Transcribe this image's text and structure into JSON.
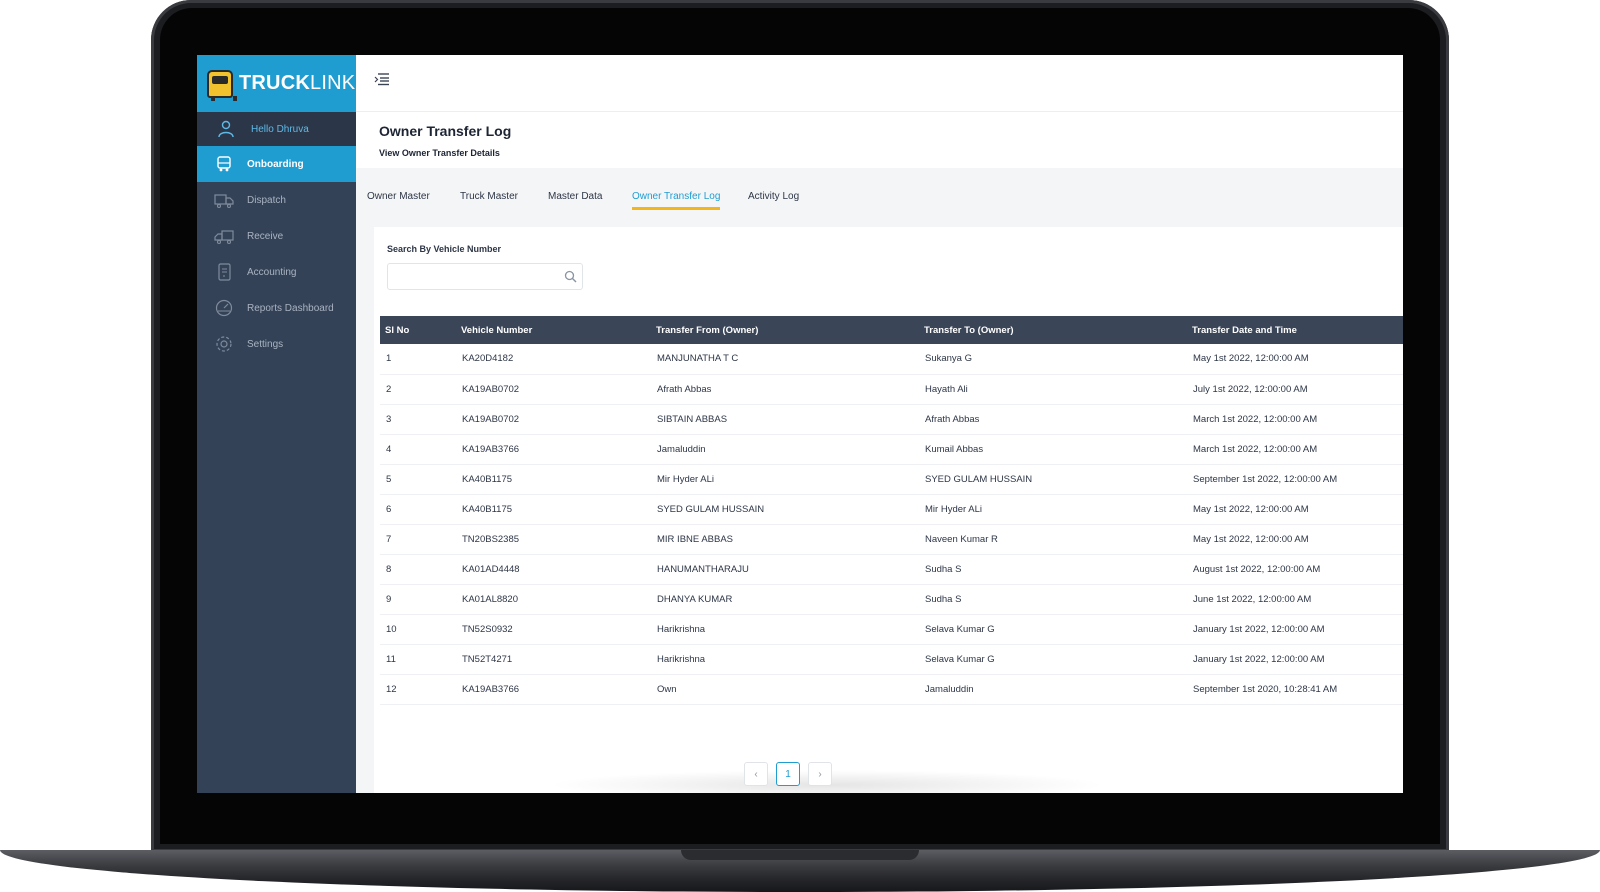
{
  "app": {
    "logo_bold": "TRUCK",
    "logo_light": "LINK"
  },
  "sidebar": {
    "user_greeting": "Hello Dhruva",
    "items": [
      {
        "label": "Onboarding",
        "icon": "bus-icon",
        "active": true
      },
      {
        "label": "Dispatch",
        "icon": "truck-icon",
        "active": false
      },
      {
        "label": "Receive",
        "icon": "truck-receive-icon",
        "active": false
      },
      {
        "label": "Accounting",
        "icon": "ledger-icon",
        "active": false
      },
      {
        "label": "Reports Dashboard",
        "icon": "dashboard-icon",
        "active": false
      },
      {
        "label": "Settings",
        "icon": "gear-icon",
        "active": false
      }
    ]
  },
  "header": {
    "title": "Owner Transfer Log",
    "subtitle": "View Owner Transfer Details"
  },
  "tabs": [
    {
      "label": "Owner Master",
      "active": false
    },
    {
      "label": "Truck Master",
      "active": false
    },
    {
      "label": "Master Data",
      "active": false
    },
    {
      "label": "Owner Transfer Log",
      "active": true
    },
    {
      "label": "Activity Log",
      "active": false
    }
  ],
  "search": {
    "label": "Search By Vehicle Number",
    "value": ""
  },
  "table": {
    "columns": [
      "Sl No",
      "Vehicle Number",
      "Transfer From (Owner)",
      "Transfer To (Owner)",
      "Transfer Date and Time"
    ],
    "rows": [
      [
        "1",
        "KA20D4182",
        "MANJUNATHA T C",
        "Sukanya G",
        "May 1st 2022, 12:00:00 AM"
      ],
      [
        "2",
        "KA19AB0702",
        "Afrath Abbas",
        "Hayath Ali",
        "July 1st 2022, 12:00:00 AM"
      ],
      [
        "3",
        "KA19AB0702",
        "SIBTAIN ABBAS",
        "Afrath Abbas",
        "March 1st 2022, 12:00:00 AM"
      ],
      [
        "4",
        "KA19AB3766",
        "Jamaluddin",
        "Kumail Abbas",
        "March 1st 2022, 12:00:00 AM"
      ],
      [
        "5",
        "KA40B1175",
        "Mir Hyder ALi",
        "SYED GULAM HUSSAIN",
        "September 1st 2022, 12:00:00 AM"
      ],
      [
        "6",
        "KA40B1175",
        "SYED GULAM HUSSAIN",
        "Mir Hyder ALi",
        "May 1st 2022, 12:00:00 AM"
      ],
      [
        "7",
        "TN20BS2385",
        "MIR IBNE ABBAS",
        "Naveen Kumar R",
        "May 1st 2022, 12:00:00 AM"
      ],
      [
        "8",
        "KA01AD4448",
        "HANUMANTHARAJU",
        "Sudha S",
        "August 1st 2022, 12:00:00 AM"
      ],
      [
        "9",
        "KA01AL8820",
        "DHANYA KUMAR",
        "Sudha S",
        "June 1st 2022, 12:00:00 AM"
      ],
      [
        "10",
        "TN52S0932",
        "Harikrishna",
        "Selava Kumar G",
        "January 1st 2022, 12:00:00 AM"
      ],
      [
        "11",
        "TN52T4271",
        "Harikrishna",
        "Selava Kumar G",
        "January 1st 2022, 12:00:00 AM"
      ],
      [
        "12",
        "KA19AB3766",
        "Own",
        "Jamaluddin",
        "September 1st 2020, 10:28:41 AM"
      ]
    ]
  },
  "pagination": {
    "prev": "‹",
    "current": "1",
    "next": "›"
  },
  "colors": {
    "accent": "#1f9dd1",
    "sidebar": "#344257",
    "table_header": "#3b4558",
    "tab_underline": "#f2b51b"
  }
}
